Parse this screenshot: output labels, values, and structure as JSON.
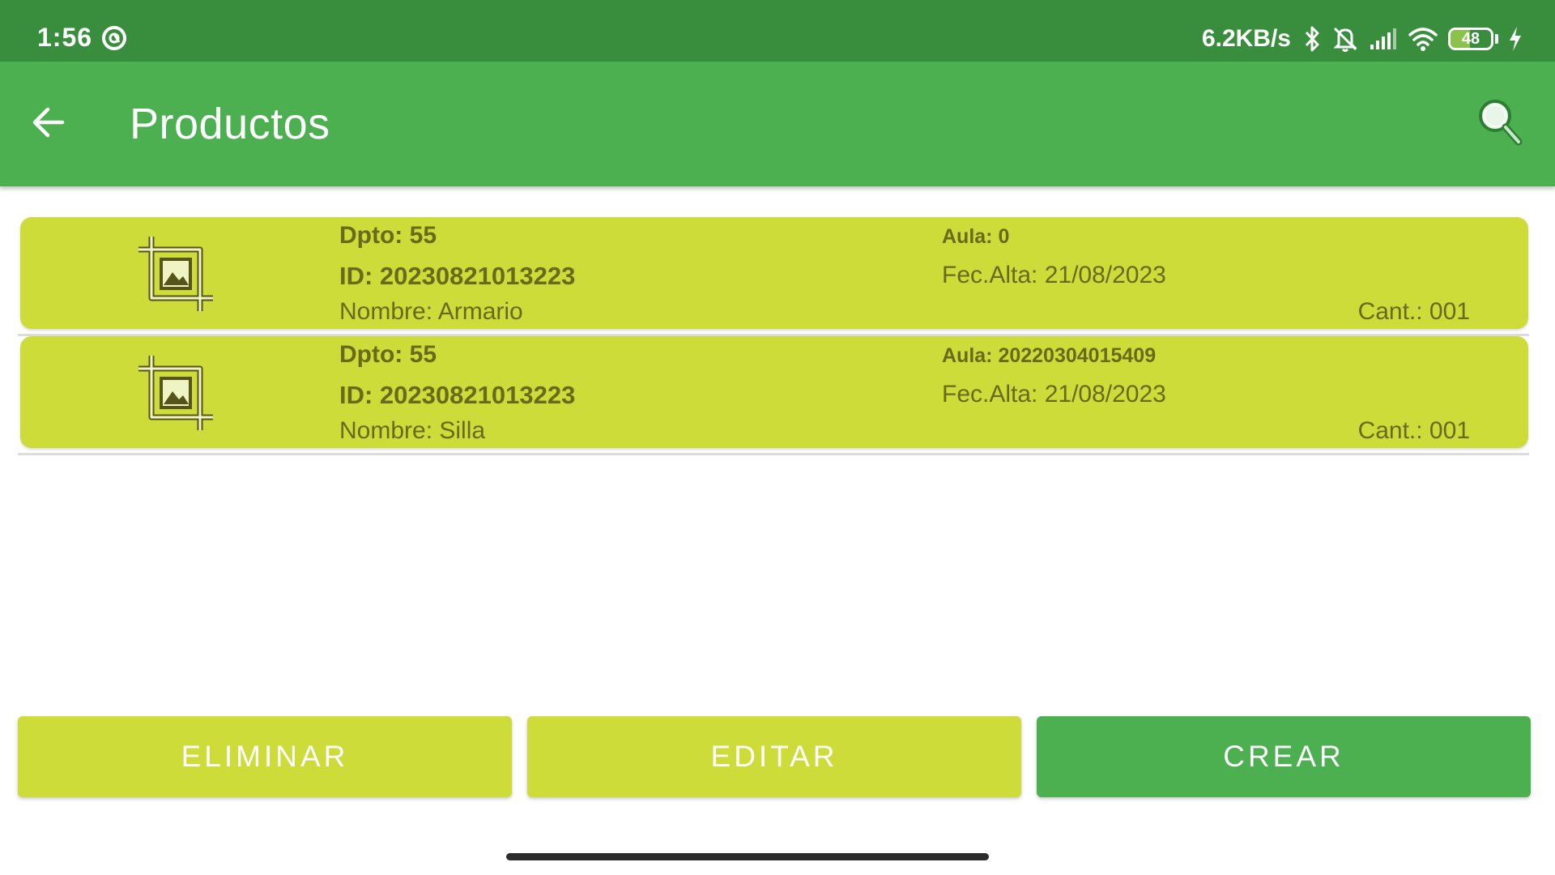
{
  "status_bar": {
    "time": "1:56",
    "net_speed": "6.2KB/s",
    "battery_level": "48",
    "battery_fraction": 0.48,
    "icons": [
      "app-notification-icon",
      "bluetooth-icon",
      "notifications-off-icon",
      "signal-icon",
      "wifi-icon",
      "battery-icon",
      "charging-icon"
    ]
  },
  "app_bar": {
    "title": "Productos",
    "back_icon": "arrow-left-icon",
    "search_icon": "search-icon"
  },
  "products": [
    {
      "dpto": "Dpto: 55",
      "id": "ID: 20230821013223",
      "nombre": "Nombre: Armario",
      "aula": "Aula: 0",
      "fec_alta": "Fec.Alta: 21/08/2023",
      "cant": "Cant.: 001",
      "thumb_icon": "image-crop-icon"
    },
    {
      "dpto": "Dpto: 55",
      "id": "ID: 20230821013223",
      "nombre": "Nombre: Silla",
      "aula": "Aula: 20220304015409",
      "fec_alta": "Fec.Alta: 21/08/2023",
      "cant": "Cant.: 001",
      "thumb_icon": "image-crop-icon"
    }
  ],
  "actions": {
    "eliminar": "ELIMINAR",
    "editar": "EDITAR",
    "crear": "CREAR"
  },
  "colors": {
    "status_bar": "#388e3c",
    "app_bar": "#4caf50",
    "card": "#cddc39",
    "card_text": "#6a6a1a",
    "primary_button": "#4caf50",
    "secondary_button": "#cddc39"
  }
}
